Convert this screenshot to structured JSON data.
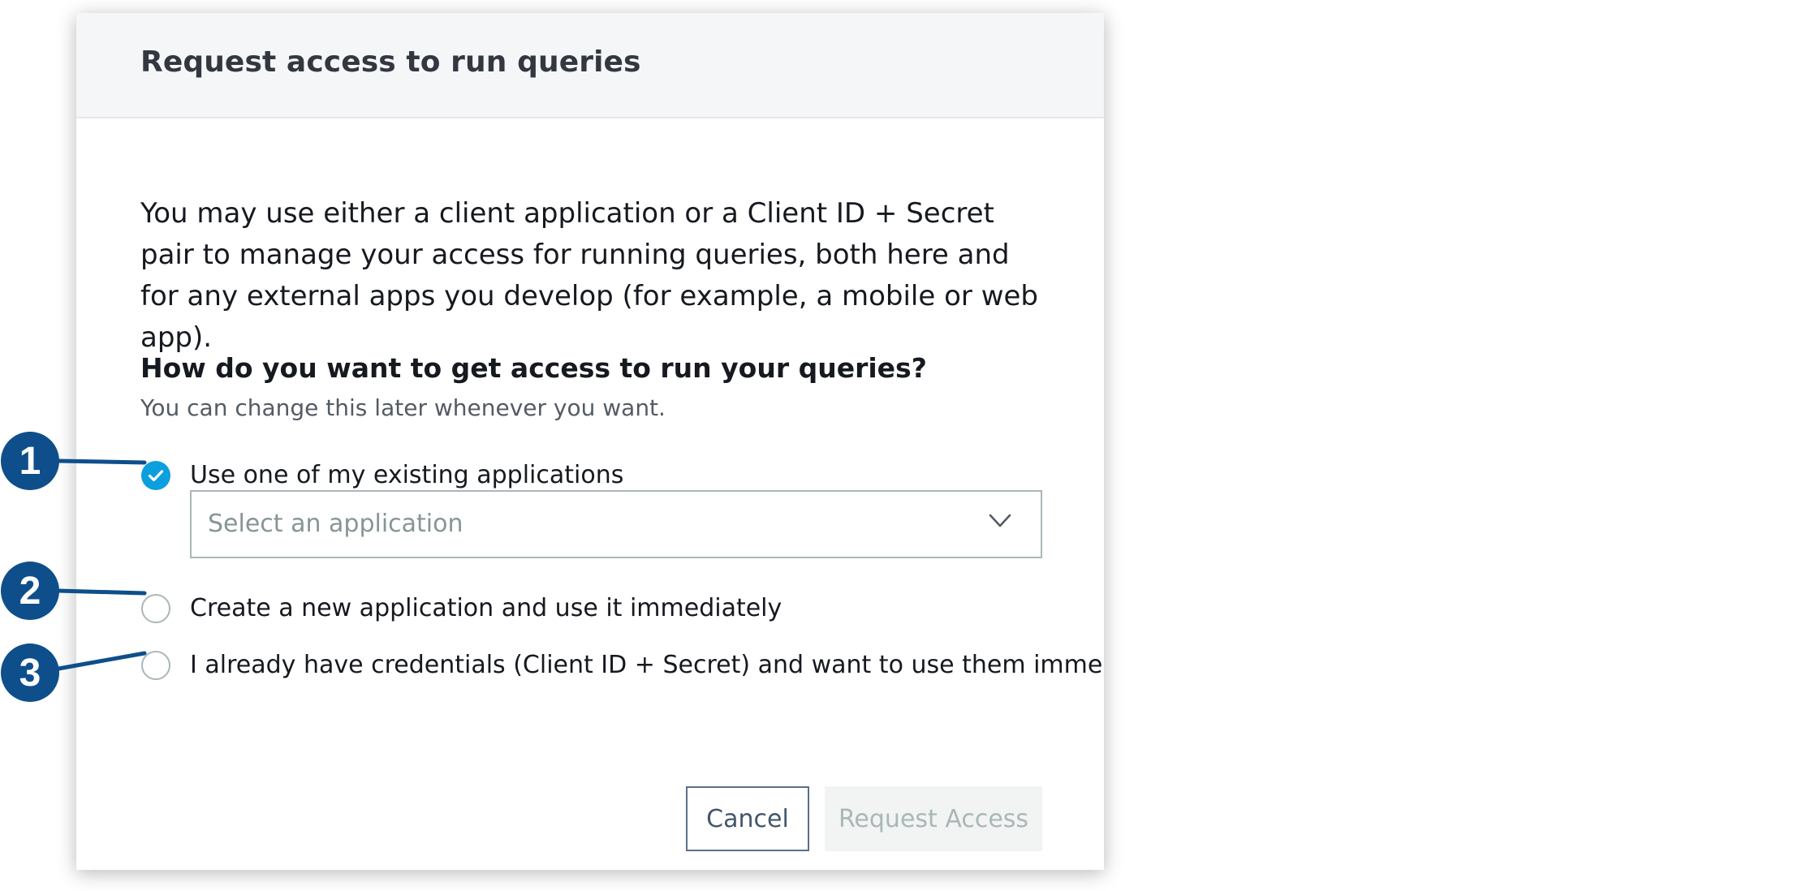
{
  "dialog": {
    "title": "Request access to run queries",
    "intro": "You may use either a client application or a Client ID + Secret pair to manage your access for running queries, both here and for any external apps you develop (for example, a mobile or web app).",
    "question": "How do you want to get access to run your queries?",
    "hint": "You can change this later whenever you want."
  },
  "options": [
    {
      "label": "Use one of my existing applications",
      "selected": true
    },
    {
      "label": "Create a new application and use it immediately",
      "selected": false
    },
    {
      "label": "I already have credentials (Client ID + Secret) and want to use them immediately",
      "selected": false
    }
  ],
  "application_select": {
    "placeholder": "Select an application",
    "icon": "chevron-down-icon"
  },
  "buttons": {
    "cancel_label": "Cancel",
    "request_label": "Request Access"
  },
  "callouts": [
    "1",
    "2",
    "3"
  ],
  "colors": {
    "accent": "#0c9fdd",
    "callout": "#0e4f8b",
    "header_bg": "#f5f6f8",
    "disabled_bg": "#f2f3f3"
  }
}
